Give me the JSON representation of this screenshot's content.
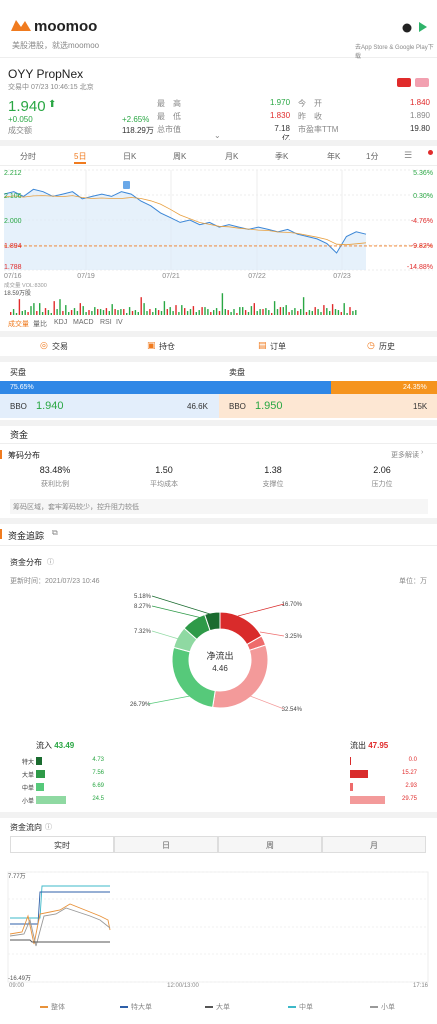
{
  "header": {
    "brand": "moomoo",
    "tagline": "美股港股，就选moomoo",
    "store_text": "去App Store & Google Play下载"
  },
  "stock": {
    "name": "OYY  PropNex",
    "status": "交易中  07/23 10:46:15 北京",
    "price": "1.940",
    "change": "+0.050",
    "change_pct": "+2.65%",
    "volume_label": "成交额",
    "volume": "118.29万",
    "stats": [
      {
        "label": "最　高",
        "value": "1.970",
        "color": "#2aa744"
      },
      {
        "label": "最　低",
        "value": "1.830",
        "color": "#e02b2b"
      },
      {
        "label": "总市值",
        "value": "7.18亿",
        "color": "#333"
      }
    ],
    "stats2": [
      {
        "label": "今　开",
        "value": "1.840",
        "color": "#e02b2b"
      },
      {
        "label": "昨　收",
        "value": "1.890",
        "color": "#888"
      },
      {
        "label": "市盈率TTM",
        "value": "19.80",
        "color": "#333"
      }
    ]
  },
  "chart_tabs": [
    "分时",
    "5日",
    "日K",
    "周K",
    "月K",
    "季K",
    "年K",
    "1分"
  ],
  "chart_data": {
    "type": "line",
    "title": "",
    "xlabel": "",
    "ylabel": "",
    "x": [
      "07/16",
      "07/19",
      "07/21",
      "07/22",
      "07/23"
    ],
    "y_ticks_left": [
      "2.212",
      "2.106",
      "2.000",
      "1.894",
      "1.788"
    ],
    "y_ticks_right": [
      "5.36%",
      "0.30%",
      "-4.76%",
      "-9.82%",
      "-14.88%"
    ],
    "ylim": [
      1.788,
      2.212
    ],
    "series": [
      {
        "values": [
          2.11,
          2.12,
          2.1,
          2.13,
          2.12,
          2.1,
          2.11,
          2.12,
          2.09,
          2.1,
          2.11,
          2.1,
          2.12,
          2.11,
          2.08,
          2.06,
          2.03,
          2.01,
          1.99,
          2.0,
          1.98,
          1.99,
          1.97,
          1.98,
          1.97,
          1.96,
          1.97,
          1.96,
          1.95,
          1.96,
          1.94,
          1.93,
          1.92,
          1.9,
          1.86,
          1.93,
          1.95,
          1.94
        ]
      }
    ],
    "volume_label": "成交量 VOL:8300",
    "volume_max": "18.59万股"
  },
  "indicator_tabs": [
    "成交量",
    "量比",
    "KDJ",
    "MACD",
    "RSI",
    "IV"
  ],
  "actions": [
    "交易",
    "持仓",
    "订单",
    "历史"
  ],
  "order_book": {
    "bid_label": "买盘",
    "ask_label": "卖盘",
    "bid_pct": "75.65%",
    "ask_pct": "24.35%",
    "bbo_label": "BBO",
    "bid_price": "1.940",
    "bid_qty": "46.6K",
    "ask_price": "1.950",
    "ask_qty": "15K"
  },
  "capital": {
    "title": "资金",
    "chip_title": "筹码分布",
    "more": "更多解读",
    "chips": [
      {
        "value": "83.48%",
        "label": "获利比例"
      },
      {
        "value": "1.50",
        "label": "平均成本"
      },
      {
        "value": "1.38",
        "label": "支撑位"
      },
      {
        "value": "2.06",
        "label": "压力位"
      }
    ],
    "chip_note": "筹码区域，套牢筹码较少，控升阻力较低"
  },
  "flow": {
    "title": "资金追踪",
    "dist_title": "资金分布",
    "updated": "更新时间：2021/07/23 10:46",
    "unit": "单位：万",
    "center_label": "净流出",
    "center_value": "4.46",
    "donut": [
      {
        "label": "5.18%",
        "value": 5.18,
        "color": "#1a6b2f"
      },
      {
        "label": "8.27%",
        "value": 8.27,
        "color": "#2e9a48"
      },
      {
        "label": "7.32%",
        "value": 7.32,
        "color": "#8fd9a2"
      },
      {
        "label": "26.79%",
        "value": 26.79,
        "color": "#56c97a"
      },
      {
        "label": "16.70%",
        "value": 16.7,
        "color": "#d92b2b"
      },
      {
        "label": "3.25%",
        "value": 3.25,
        "color": "#ee6b6b"
      },
      {
        "label": "32.54%",
        "value": 32.54,
        "color": "#f39a9a"
      }
    ],
    "in_label": "流入",
    "in_total": "43.49",
    "out_label": "流出",
    "out_total": "47.95",
    "rows": [
      {
        "label": "特大",
        "in": "4.73",
        "out": "0.0"
      },
      {
        "label": "大单",
        "in": "7.56",
        "out": "15.27"
      },
      {
        "label": "中单",
        "in": "6.69",
        "out": "2.93"
      },
      {
        "label": "小单",
        "in": "24.5",
        "out": "29.75"
      }
    ],
    "trend_title": "资金流向",
    "trend_tabs": [
      "实时",
      "日",
      "周",
      "月"
    ],
    "trend_y": [
      "7.77万",
      "-16.49万"
    ],
    "trend_x": [
      "09:00",
      "12:00/13:00",
      "17:16"
    ],
    "legend": [
      {
        "name": "整体",
        "color": "#e8923a"
      },
      {
        "name": "特大单",
        "color": "#2e5fa8"
      },
      {
        "name": "大单",
        "color": "#555"
      },
      {
        "name": "中单",
        "color": "#3cb8c8"
      },
      {
        "name": "小单",
        "color": "#999"
      }
    ]
  }
}
